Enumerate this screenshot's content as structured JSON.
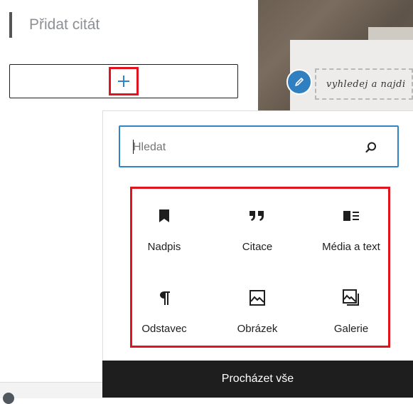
{
  "editor": {
    "quote_placeholder": "Přidat citát",
    "image_caption_placeholder": "vyhledej a najdi"
  },
  "inserter": {
    "search_placeholder": "Hledat",
    "blocks": [
      {
        "label": "Nadpis",
        "icon": "bookmark-icon"
      },
      {
        "label": "Citace",
        "icon": "quote-icon"
      },
      {
        "label": "Média a text",
        "icon": "media-text-icon"
      },
      {
        "label": "Odstavec",
        "icon": "paragraph-icon"
      },
      {
        "label": "Obrázek",
        "icon": "image-icon"
      },
      {
        "label": "Galerie",
        "icon": "gallery-icon"
      }
    ],
    "browse_all_label": "Procházet vše"
  },
  "colors": {
    "highlight": "#e0141e",
    "accent": "#2e85c7",
    "dark": "#1e1e1e"
  }
}
